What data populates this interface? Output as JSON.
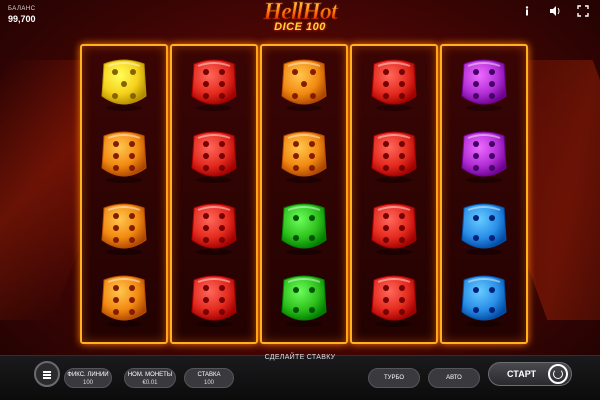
{
  "header": {
    "balance_label": "БАЛАНС",
    "balance_value": "99,700",
    "icons": [
      "info-icon",
      "sound-icon",
      "fullscreen-icon"
    ]
  },
  "logo": {
    "main": "HellHot",
    "sub": "DICE 100"
  },
  "reels": [
    [
      "yellow",
      "orange",
      "orange",
      "orange"
    ],
    [
      "red",
      "red",
      "red",
      "red"
    ],
    [
      "orange",
      "orange",
      "green",
      "green"
    ],
    [
      "red",
      "red",
      "red",
      "red"
    ],
    [
      "purple",
      "purple",
      "blue",
      "blue"
    ]
  ],
  "die_colors": {
    "yellow": "#f5d11c",
    "orange": "#f28a12",
    "red": "#e52b1f",
    "green": "#2fc21e",
    "purple": "#b22fd6",
    "blue": "#2a8fe8"
  },
  "controls": {
    "prompt": "СДЕЛАЙТЕ СТАВКУ",
    "fixed_lines_label": "ФИКС. ЛИНИИ",
    "fixed_lines_value": "100",
    "coin_label": "НОМ. МОНЕТЫ",
    "coin_value": "€0.01",
    "bet_label": "СТАВКА",
    "bet_value": "100",
    "turbo_label": "ТУРБО",
    "auto_label": "АВТО",
    "start_label": "СТАРТ"
  }
}
